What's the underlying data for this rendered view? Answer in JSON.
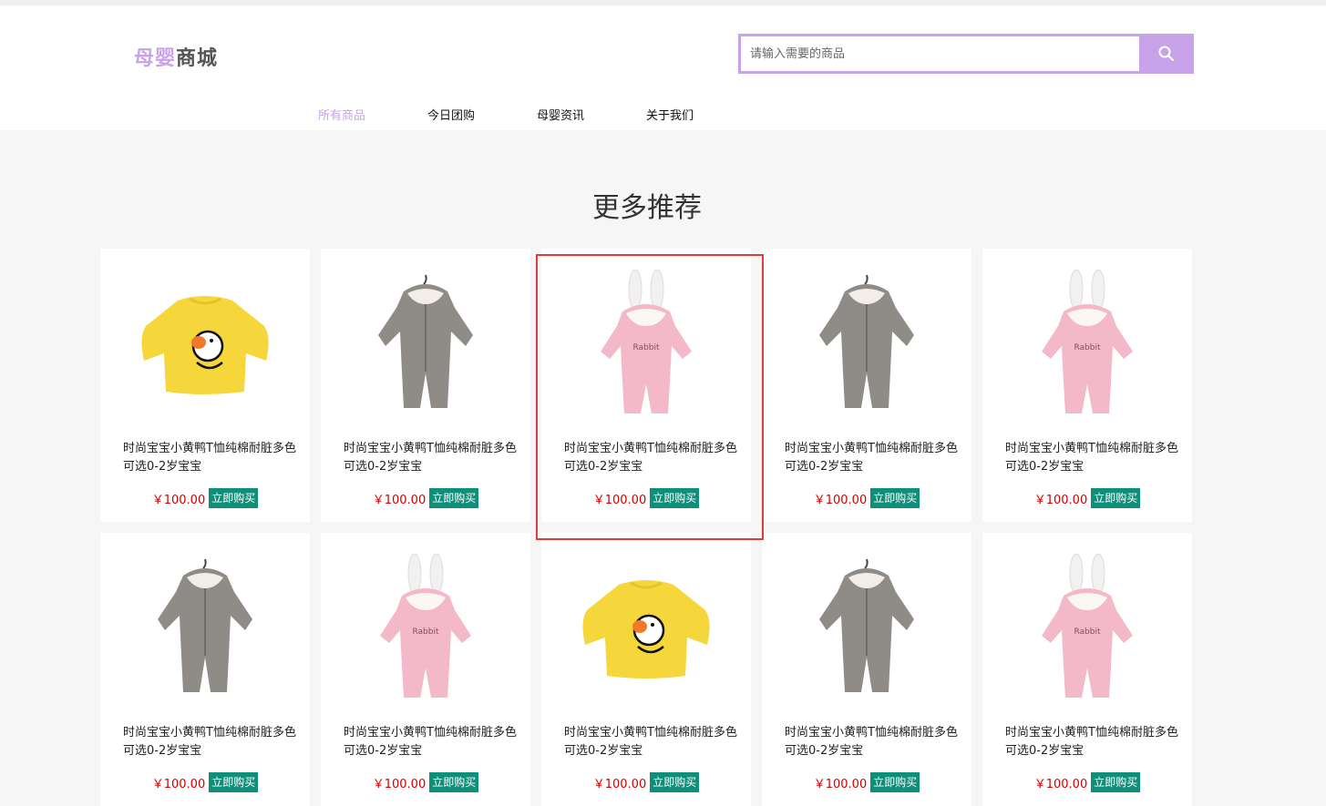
{
  "header": {
    "logo_part1": "母婴",
    "logo_part2": "商城",
    "search_placeholder": "请输入需要的商品"
  },
  "nav": [
    {
      "label": "所有商品",
      "active": true
    },
    {
      "label": "今日团购",
      "active": false
    },
    {
      "label": "母婴资讯",
      "active": false
    },
    {
      "label": "关于我们",
      "active": false
    }
  ],
  "section_title": "更多推荐",
  "colors": {
    "accent": "#c9a3ea",
    "price": "#d40000",
    "buy_button": "#0f8f7a",
    "highlight": "#e23b3b"
  },
  "products": [
    {
      "image": "yellow-duck-tshirt",
      "title": "时尚宝宝小黄鸭T恤纯棉耐脏多色可选0-2岁宝宝",
      "price": "￥100.00",
      "buy_label": "立即购买"
    },
    {
      "image": "grey-fleece-romper",
      "title": "时尚宝宝小黄鸭T恤纯棉耐脏多色可选0-2岁宝宝",
      "price": "￥100.00",
      "buy_label": "立即购买"
    },
    {
      "image": "pink-rabbit-romper",
      "title": "时尚宝宝小黄鸭T恤纯棉耐脏多色可选0-2岁宝宝",
      "price": "￥100.00",
      "buy_label": "立即购买"
    },
    {
      "image": "grey-fleece-romper",
      "title": "时尚宝宝小黄鸭T恤纯棉耐脏多色可选0-2岁宝宝",
      "price": "￥100.00",
      "buy_label": "立即购买"
    },
    {
      "image": "pink-rabbit-romper",
      "title": "时尚宝宝小黄鸭T恤纯棉耐脏多色可选0-2岁宝宝",
      "price": "￥100.00",
      "buy_label": "立即购买"
    },
    {
      "image": "grey-fleece-romper",
      "title": "时尚宝宝小黄鸭T恤纯棉耐脏多色可选0-2岁宝宝",
      "price": "￥100.00",
      "buy_label": "立即购买"
    },
    {
      "image": "pink-rabbit-romper",
      "title": "时尚宝宝小黄鸭T恤纯棉耐脏多色可选0-2岁宝宝",
      "price": "￥100.00",
      "buy_label": "立即购买"
    },
    {
      "image": "yellow-duck-tshirt",
      "title": "时尚宝宝小黄鸭T恤纯棉耐脏多色可选0-2岁宝宝",
      "price": "￥100.00",
      "buy_label": "立即购买"
    },
    {
      "image": "grey-fleece-romper",
      "title": "时尚宝宝小黄鸭T恤纯棉耐脏多色可选0-2岁宝宝",
      "price": "￥100.00",
      "buy_label": "立即购买"
    },
    {
      "image": "pink-rabbit-romper",
      "title": "时尚宝宝小黄鸭T恤纯棉耐脏多色可选0-2岁宝宝",
      "price": "￥100.00",
      "buy_label": "立即购买"
    }
  ]
}
